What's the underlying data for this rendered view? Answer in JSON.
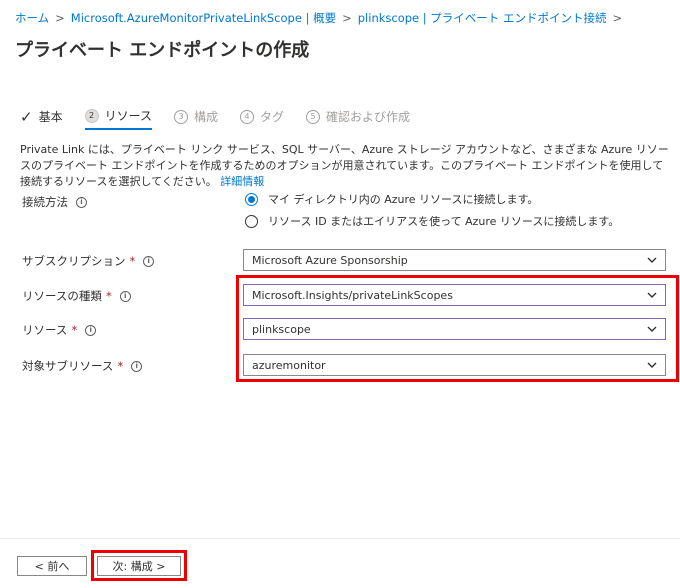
{
  "breadcrumb": {
    "items": [
      "ホーム",
      "Microsoft.AzureMonitorPrivateLinkScope | 概要",
      "plinkscope | プライベート エンドポイント接続"
    ],
    "separator": ">"
  },
  "page_title": "プライベート エンドポイントの作成",
  "tabs": [
    {
      "label": "基本",
      "state": "completed"
    },
    {
      "num": "2",
      "label": "リソース",
      "state": "active"
    },
    {
      "num": "3",
      "label": "構成",
      "state": "disabled"
    },
    {
      "num": "4",
      "label": "タグ",
      "state": "disabled"
    },
    {
      "num": "5",
      "label": "確認および作成",
      "state": "disabled"
    }
  ],
  "intro": {
    "text": "Private Link には、プライベート リンク サービス、SQL サーバー、Azure ストレージ アカウントなど、さまざまな Azure リソースのプライベート エンドポイントを作成するためのオプションが用意されています。このプライベート エンドポイントを使用して接続するリソースを選択してください。",
    "link": "詳細情報"
  },
  "connection": {
    "label": "接続方法",
    "options": [
      {
        "label": "マイ ディレクトリ内の Azure リソースに接続します。",
        "checked": true
      },
      {
        "label": "リソース ID またはエイリアスを使って Azure リソースに接続します。",
        "checked": false
      }
    ]
  },
  "fields": {
    "subscription": {
      "label": "サブスクリプション",
      "value": "Microsoft Azure Sponsorship"
    },
    "resource_type": {
      "label": "リソースの種類",
      "value": "Microsoft.Insights/privateLinkScopes"
    },
    "resource": {
      "label": "リソース",
      "value": "plinkscope"
    },
    "subresource": {
      "label": "対象サブリソース",
      "value": "azuremonitor"
    }
  },
  "required_mark": "*",
  "info_glyph": "i",
  "footer": {
    "prev_label": "< 前へ",
    "next_label": "次: 構成 >"
  },
  "colors": {
    "accent": "#0078d4",
    "highlight": "#e00000",
    "focus_border": "#8764b8"
  }
}
